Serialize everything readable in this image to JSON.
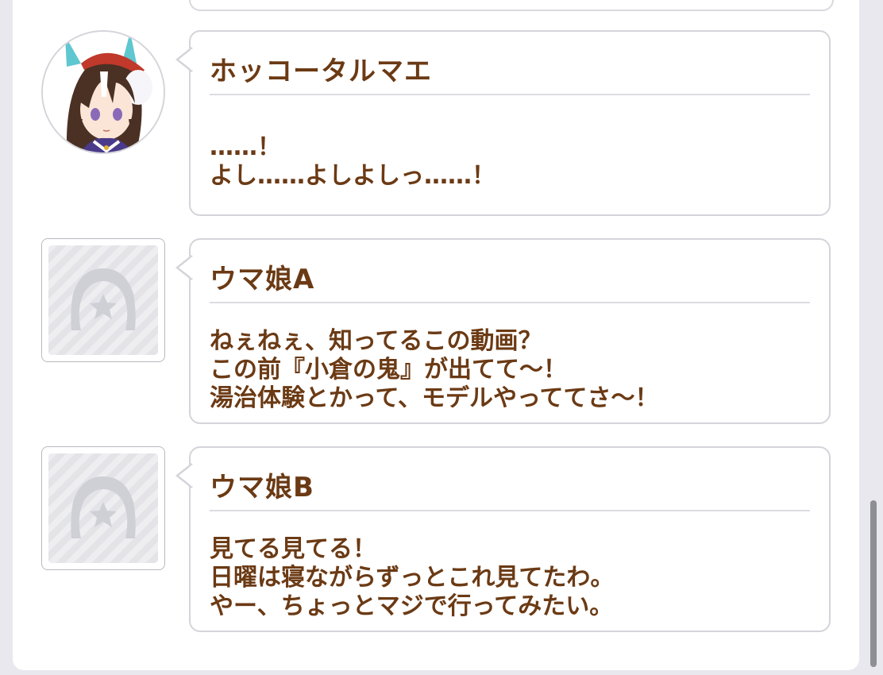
{
  "messages": [
    {
      "name": "ホッコータルマエ",
      "lines": "……！\nよし……よしよしっ……！",
      "avatar": "character-portrait"
    },
    {
      "name": "ウマ娘A",
      "lines": "ねぇねぇ、知ってるこの動画？\nこの前『小倉の鬼』が出てて～！\n湯治体験とかって、モデルやっててさ～！",
      "avatar": "horseshoe-placeholder-icon"
    },
    {
      "name": "ウマ娘B",
      "lines": "見てる見てる！\n日曜は寝ながらずっとこれ見てたわ。\nやー、ちょっとマジで行ってみたい。",
      "avatar": "horseshoe-placeholder-icon"
    }
  ],
  "colors": {
    "text": "#6b3a14",
    "bubble_border": "#d4d4da",
    "background": "#e9e8ee"
  }
}
